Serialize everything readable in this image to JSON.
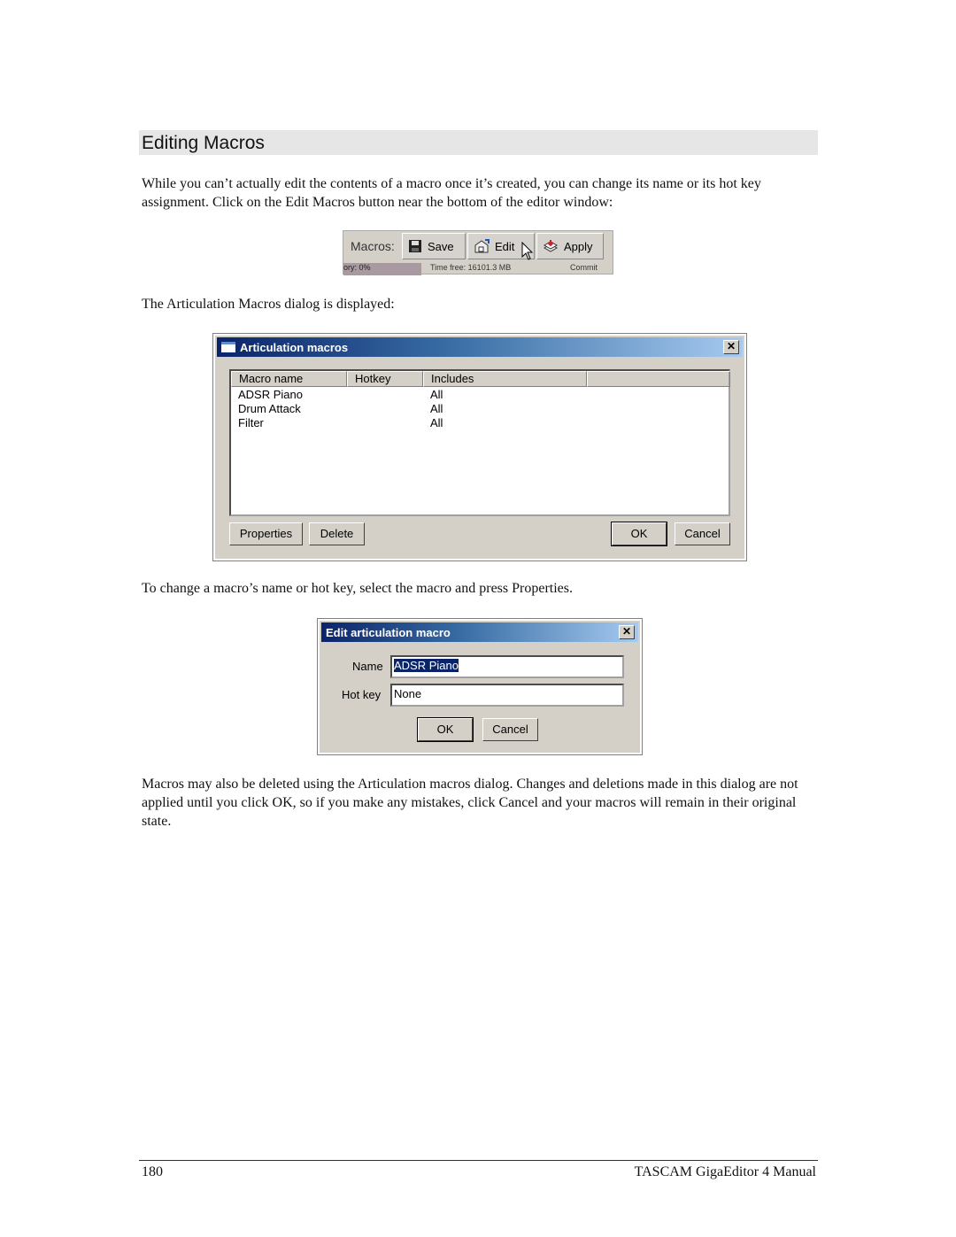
{
  "page": {
    "heading": "Editing Macros",
    "paragraphs": [
      "While you can’t actually edit the contents of a macro once it’s created, you can change its name or its hot key assignment.  Click on the Edit Macros button near the bottom of the editor window:",
      "The Articulation Macros dialog is displayed:",
      "To change a macro’s name or hot key, select the macro and press Properties.",
      "Macros may also be deleted using the Articulation macros dialog.  Changes and deletions made in this dialog are not applied until you click OK, so if you make any mistakes, click Cancel and your macros will remain in their original state."
    ],
    "footer": {
      "page_number": "180",
      "manual_title": "TASCAM GigaEditor 4 Manual"
    }
  },
  "toolbar": {
    "label": "Macros:",
    "buttons": [
      {
        "label": "Save",
        "icon": "floppy-disk-icon"
      },
      {
        "label": "Edit",
        "icon": "edit-house-icon"
      },
      {
        "label": "Apply",
        "icon": "apply-stack-icon"
      }
    ],
    "status": [
      "ory: 0%",
      "Time free: 16101.3 MB",
      "Commit"
    ]
  },
  "articulation_dialog": {
    "title": "Articulation macros",
    "columns": [
      "Macro name",
      "Hotkey",
      "Includes",
      ""
    ],
    "rows": [
      {
        "name": "ADSR Piano",
        "hotkey": "",
        "includes": "All"
      },
      {
        "name": "Drum Attack",
        "hotkey": "",
        "includes": "All"
      },
      {
        "name": "Filter",
        "hotkey": "",
        "includes": "All"
      }
    ],
    "buttons": {
      "properties": "Properties",
      "delete": "Delete",
      "ok": "OK",
      "cancel": "Cancel"
    }
  },
  "edit_dialog": {
    "title": "Edit articulation macro",
    "name_label": "Name",
    "name_value": "ADSR Piano",
    "hotkey_label": "Hot key",
    "hotkey_value": "None",
    "buttons": {
      "ok": "OK",
      "cancel": "Cancel"
    }
  }
}
